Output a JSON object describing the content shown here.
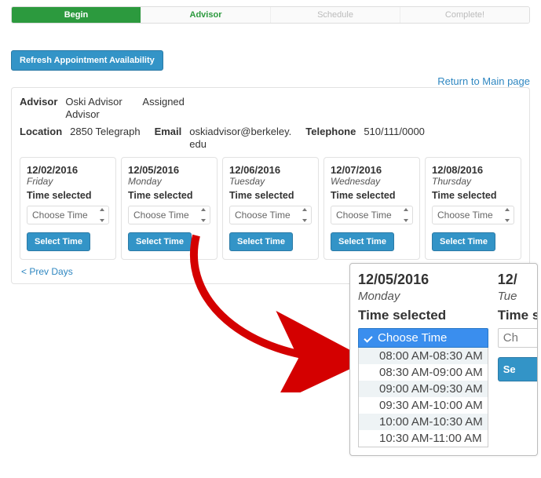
{
  "steps": {
    "begin": "Begin",
    "advisor": "Advisor",
    "schedule": "Schedule",
    "complete": "Complete!"
  },
  "actions": {
    "refresh": "Refresh Appointment Availability",
    "return_link": "Return to Main page",
    "prev": "< Prev Days",
    "select_time": "Select Time",
    "choose": "Choose Time",
    "time_selected": "Time selected"
  },
  "info": {
    "labels": {
      "advisor": "Advisor",
      "location": "Location",
      "email": "Email",
      "telephone": "Telephone"
    },
    "advisor_name": "Oski Advisor Advisor",
    "advisor_status": "Assigned",
    "location": "2850 Telegraph",
    "email": "oskiadvisor@berkeley.edu",
    "telephone": "510/111/0000"
  },
  "days": [
    {
      "date": "12/02/2016",
      "dow": "Friday"
    },
    {
      "date": "12/05/2016",
      "dow": "Monday"
    },
    {
      "date": "12/06/2016",
      "dow": "Tuesday"
    },
    {
      "date": "12/07/2016",
      "dow": "Wednesday"
    },
    {
      "date": "12/08/2016",
      "dow": "Thursday"
    }
  ],
  "zoom": {
    "main": {
      "date": "12/05/2016",
      "dow": "Monday"
    },
    "second": {
      "date": "12/",
      "dow": "Tue"
    },
    "options": [
      "08:00 AM-08:30 AM",
      "08:30 AM-09:00 AM",
      "09:00 AM-09:30 AM",
      "09:30 AM-10:00 AM",
      "10:00 AM-10:30 AM",
      "10:30 AM-11:00 AM"
    ],
    "second_choose": "Ch",
    "second_btn": "Se"
  }
}
